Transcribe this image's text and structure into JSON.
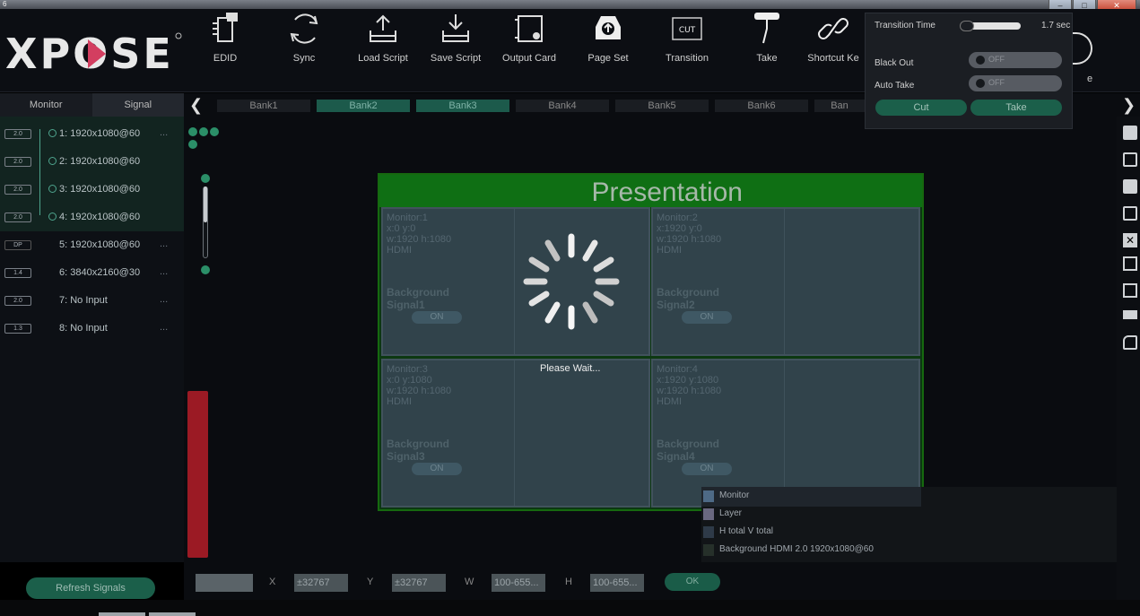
{
  "app": {
    "title_icon": "6",
    "window_controls": {
      "minimize": "–",
      "maximize": "□",
      "close": "✕"
    }
  },
  "toolbar": {
    "logo_text": "XPOSE",
    "tools": [
      {
        "label": "EDID",
        "icon": "chip-icon"
      },
      {
        "label": "Sync",
        "icon": "sync-icon"
      },
      {
        "label": "Load Script",
        "icon": "load-icon"
      },
      {
        "label": "Save Script",
        "icon": "save-icon"
      },
      {
        "label": "Output Card",
        "icon": "card-icon"
      },
      {
        "label": "Page Set",
        "icon": "upload-icon"
      },
      {
        "label": "Transition",
        "icon": "cut-icon"
      },
      {
        "label": "Take",
        "icon": "take-icon"
      },
      {
        "label": "Shortcut Ke",
        "icon": "link-icon"
      }
    ],
    "hidden_tail_label": "e",
    "cut_badge": "CUT"
  },
  "tabs": {
    "monitor": "Monitor",
    "signal": "Signal"
  },
  "banks": [
    "Bank1",
    "Bank2",
    "Bank3",
    "Bank4",
    "Bank5",
    "Bank6",
    "Ban"
  ],
  "transition_panel": {
    "time_label": "Transition Time",
    "time_value": "1.7 sec",
    "time_level": 0.85,
    "blackout_label": "Black Out",
    "blackout_state": "OFF",
    "autotake_label": "Auto Take",
    "autotake_state": "OFF",
    "cut_button": "Cut",
    "take_button": "Take"
  },
  "signals": [
    {
      "badge": "2.0",
      "name": "1: 1920x1080@60",
      "more": "..."
    },
    {
      "badge": "2.0",
      "name": "2: 1920x1080@60",
      "more": ""
    },
    {
      "badge": "2.0",
      "name": "3: 1920x1080@60",
      "more": ""
    },
    {
      "badge": "2.0",
      "name": "4: 1920x1080@60",
      "more": ""
    },
    {
      "badge": "DP",
      "name": "5: 1920x1080@60",
      "more": "..."
    },
    {
      "badge": "1.4",
      "name": "6: 3840x2160@30",
      "more": "..."
    },
    {
      "badge": "2.0",
      "name": "7: No Input",
      "more": "..."
    },
    {
      "badge": "1.3",
      "name": "8: No Input",
      "more": "..."
    }
  ],
  "refresh_button": "Refresh Signals",
  "presentation": {
    "title": "Presentation",
    "monitors": [
      {
        "lines": [
          "Monitor:1",
          "x:0  y:0",
          "w:1920  h:1080",
          "HDMI"
        ],
        "bg1": "Background",
        "bg2": "Signal1",
        "toggle": "ON"
      },
      {
        "lines": [
          "Monitor:2",
          "x:1920  y:0",
          "w:1920  h:1080",
          "HDMI"
        ],
        "bg1": "Background",
        "bg2": "Signal2",
        "toggle": "ON"
      },
      {
        "lines": [
          "Monitor:3",
          "x:0  y:1080",
          "w:1920  h:1080",
          "HDMI"
        ],
        "bg1": "Background",
        "bg2": "Signal3",
        "toggle": "ON"
      },
      {
        "lines": [
          "Monitor:4",
          "x:1920  y:1080",
          "w:1920  h:1080",
          "HDMI"
        ],
        "bg1": "Background",
        "bg2": "Signal4",
        "toggle": "ON"
      }
    ]
  },
  "wait_text": "Please Wait...",
  "legend": [
    {
      "label": "Monitor",
      "color": "#4e6a86"
    },
    {
      "label": "Layer",
      "color": "#6a6880"
    },
    {
      "label": "H total V total",
      "color": "#2e3a48"
    },
    {
      "label": "Background  HDMI 2.0 1920x1080@60",
      "color": "#26302a"
    }
  ],
  "bottom_fields": {
    "x_label": "X",
    "x_placeholder": "±32767",
    "y_label": "Y",
    "y_placeholder": "±32767",
    "w_label": "W",
    "w_placeholder": "100-655...",
    "h_label": "H",
    "h_placeholder": "100-655...",
    "ok_button": "OK"
  },
  "colors": {
    "accent": "#1b5f4a",
    "presentation_border": "#16690f",
    "red_bar": "#9b1a24"
  }
}
